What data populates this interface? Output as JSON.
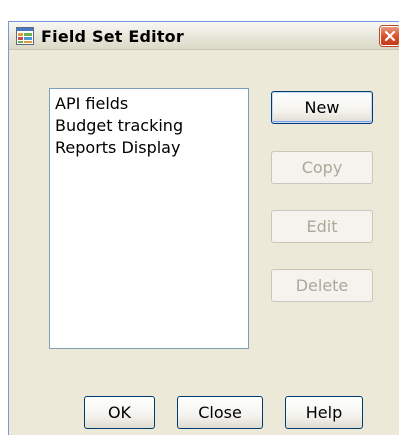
{
  "window": {
    "title": "Field Set Editor",
    "icon": "field-set-editor-icon",
    "close_icon": "close-icon"
  },
  "field_sets": {
    "items": [
      "API fields",
      "Budget tracking",
      "Reports Display"
    ]
  },
  "side_buttons": {
    "new_label": "New",
    "copy_label": "Copy",
    "edit_label": "Edit",
    "delete_label": "Delete"
  },
  "bottom_buttons": {
    "ok_label": "OK",
    "close_label": "Close",
    "help_label": "Help"
  },
  "colors": {
    "dialog_background": "#ece9d8",
    "close_button": "#d9532f",
    "button_border": "#003c74",
    "disabled_text": "#aca899"
  }
}
